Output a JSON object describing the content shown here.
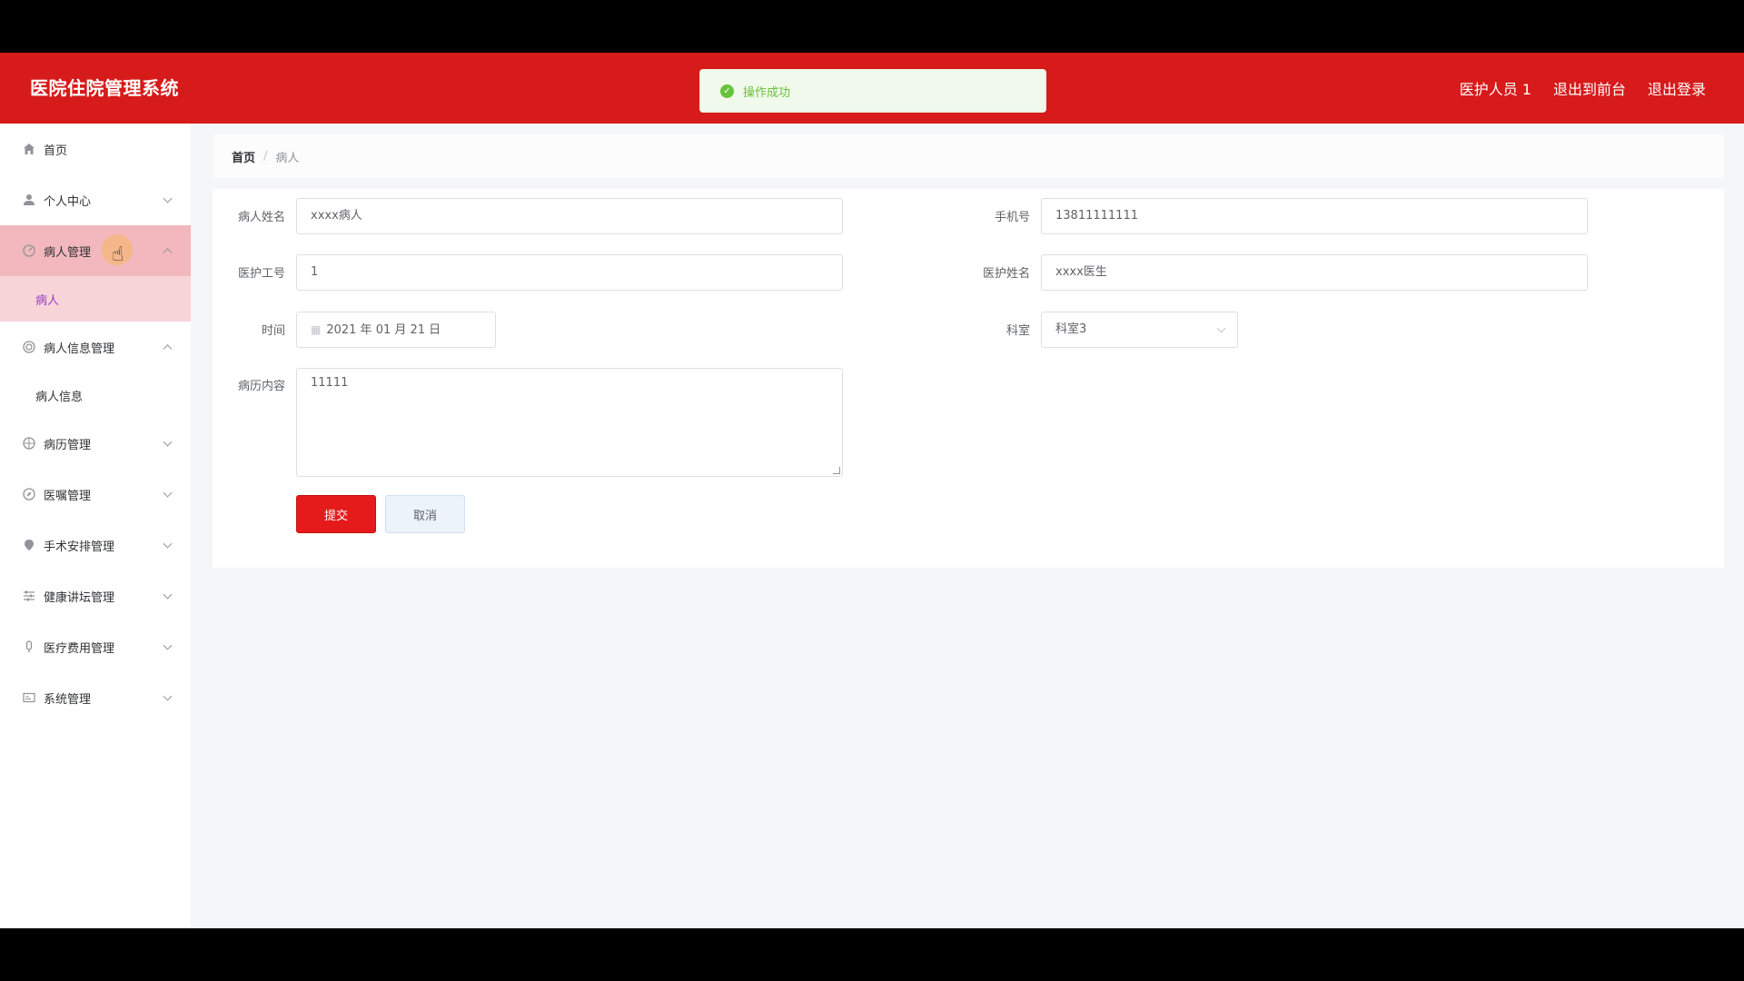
{
  "header": {
    "title": "医院住院管理系统",
    "user": "医护人员 1",
    "to_front": "退出到前台",
    "logout": "退出登录"
  },
  "toast": {
    "message": "操作成功"
  },
  "sidebar": {
    "items": [
      {
        "label": "首页",
        "icon": "home-icon"
      },
      {
        "label": "个人中心",
        "icon": "user-icon"
      },
      {
        "label": "病人管理",
        "icon": "patient-icon",
        "sub": [
          "病人"
        ]
      },
      {
        "label": "病人信息管理",
        "icon": "info-icon",
        "sub": [
          "病人信息"
        ]
      },
      {
        "label": "病历管理",
        "icon": "record-icon"
      },
      {
        "label": "医嘱管理",
        "icon": "compass-icon"
      },
      {
        "label": "手术安排管理",
        "icon": "location-icon"
      },
      {
        "label": "健康讲坛管理",
        "icon": "sliders-icon"
      },
      {
        "label": "医疗费用管理",
        "icon": "mic-icon"
      },
      {
        "label": "系统管理",
        "icon": "system-icon"
      }
    ]
  },
  "breadcrumb": {
    "home": "首页",
    "sep": "/",
    "current": "病人"
  },
  "form": {
    "patient_name_label": "病人姓名",
    "patient_name_value": "xxxx病人",
    "phone_label": "手机号",
    "phone_value": "13811111111",
    "staff_id_label": "医护工号",
    "staff_id_value": "1",
    "staff_name_label": "医护姓名",
    "staff_name_value": "xxxx医生",
    "time_label": "时间",
    "time_value": "2021 年 01 月 21 日",
    "dept_label": "科室",
    "dept_value": "科室3",
    "record_label": "病历内容",
    "record_value": "11111",
    "submit_label": "提交",
    "cancel_label": "取消"
  },
  "colors": {
    "brand": "#d71a1a",
    "success": "#67c23a",
    "active_menu": "#f2b8bd"
  }
}
